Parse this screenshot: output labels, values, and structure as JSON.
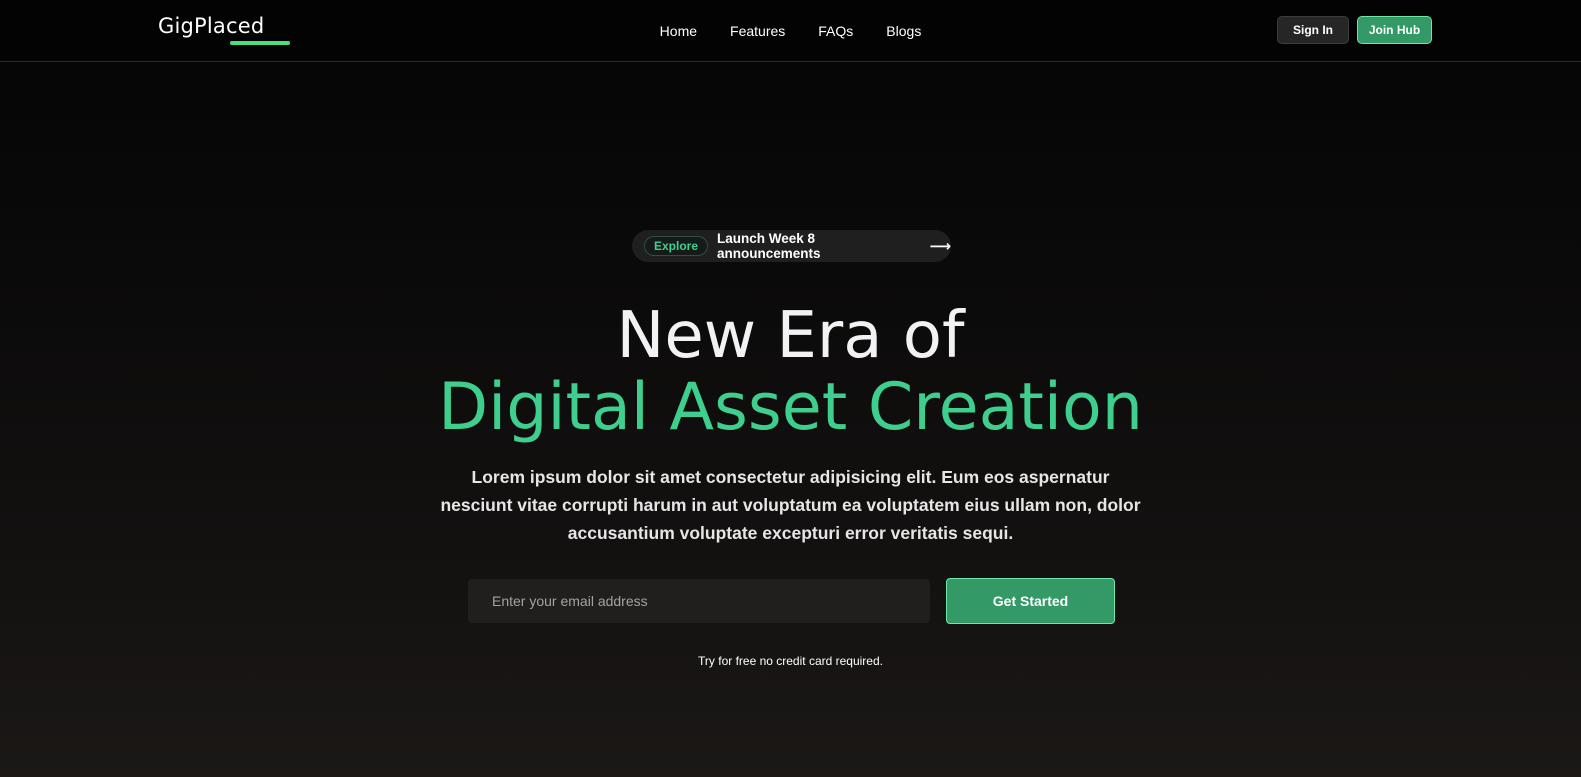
{
  "brand": {
    "name": "GigPlaced",
    "accent": "#4ade80"
  },
  "nav": {
    "links": [
      "Home",
      "Features",
      "FAQs",
      "Blogs"
    ],
    "sign_in": "Sign In",
    "join": "Join Hub"
  },
  "announcement": {
    "badge": "Explore",
    "text": "Launch Week 8 announcements",
    "arrow": "⟶"
  },
  "hero": {
    "title_line1": "New Era of",
    "title_line2": "Digital Asset Creation",
    "description": "Lorem ipsum dolor sit amet consectetur adipisicing elit. Eum eos aspernatur nesciunt vitae corrupti harum in aut voluptatum ea voluptatem eius ullam non, dolor accusantium voluptate excepturi error veritatis sequi.",
    "email_placeholder": "Enter your email address",
    "cta": "Get Started",
    "note": "Try for free no credit card required."
  },
  "colors": {
    "green": "#3ecf8e",
    "button_green": "#339966",
    "background": "#0b0a0a"
  }
}
